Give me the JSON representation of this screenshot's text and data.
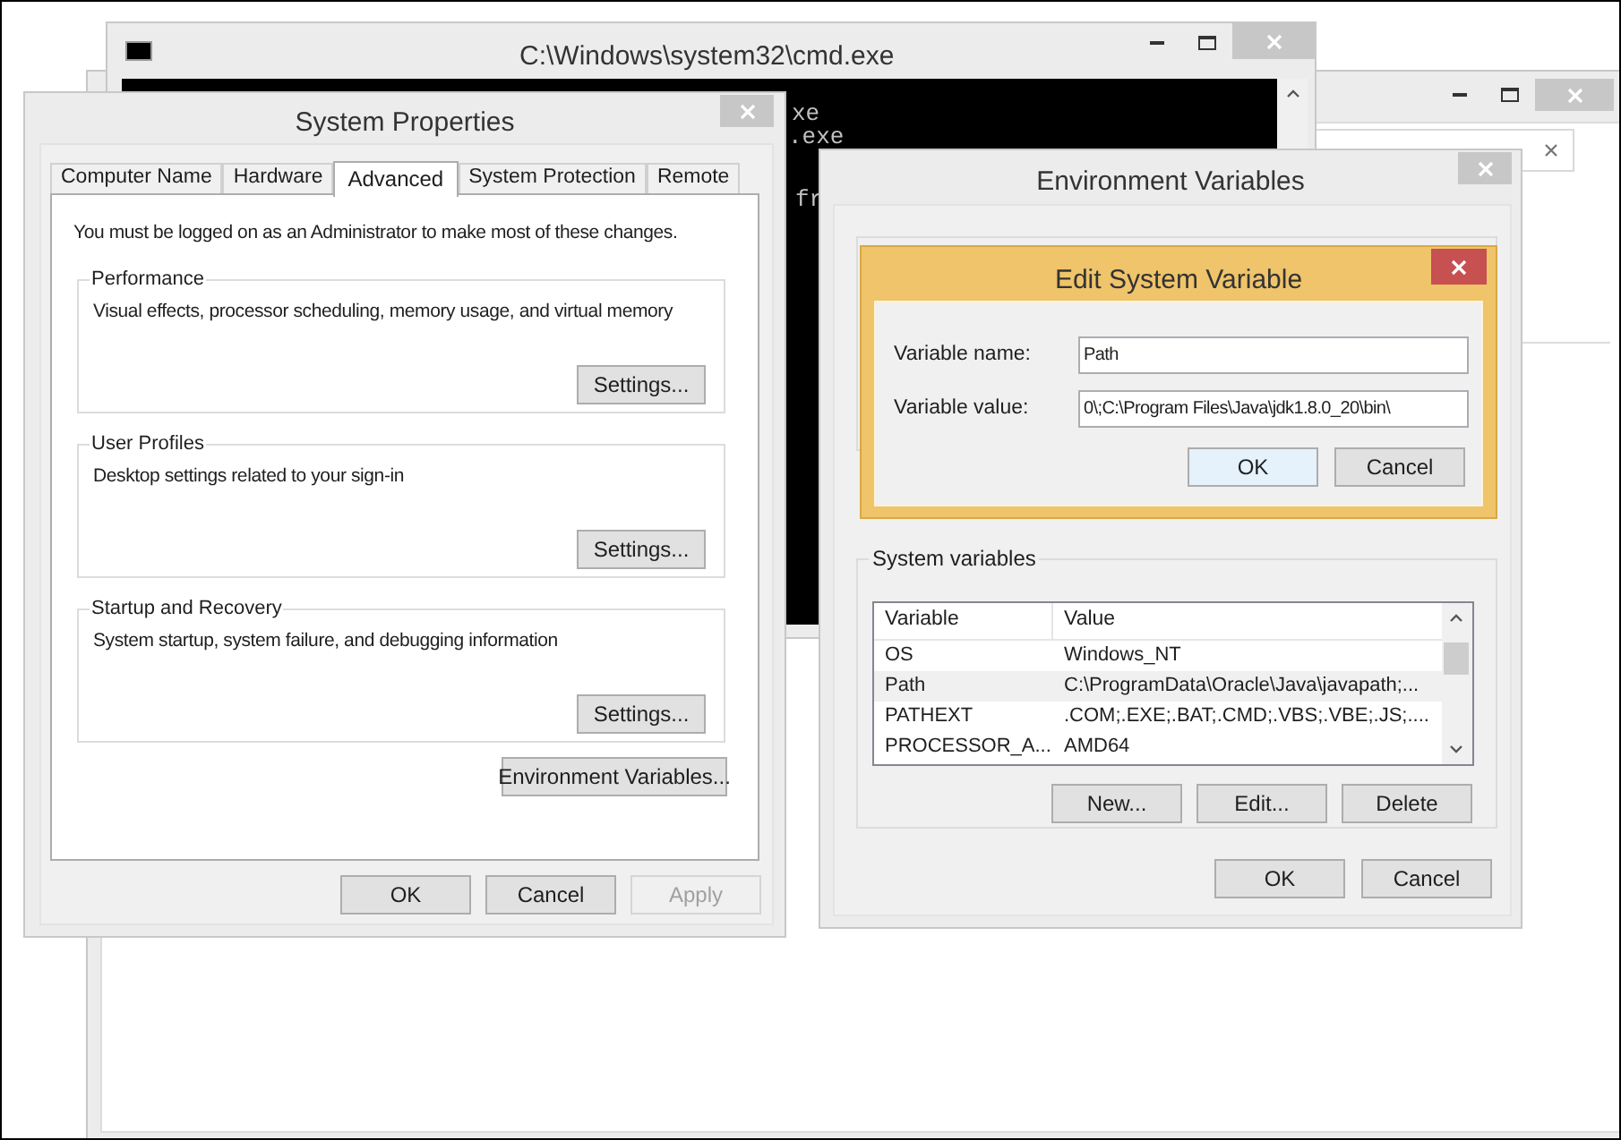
{
  "cmd_window": {
    "title": "C:\\Windows\\system32\\cmd.exe",
    "lines": [
      "xe",
      ".exe",
      "fr"
    ]
  },
  "system_properties": {
    "title": "System Properties",
    "tabs": [
      {
        "label": "Computer Name",
        "selected": false
      },
      {
        "label": "Hardware",
        "selected": false
      },
      {
        "label": "Advanced",
        "selected": true
      },
      {
        "label": "System Protection",
        "selected": false
      },
      {
        "label": "Remote",
        "selected": false
      }
    ],
    "notice": "You must be logged on as an Administrator to make most of these changes.",
    "groups": [
      {
        "title": "Performance",
        "description": "Visual effects, processor scheduling, memory usage, and virtual memory",
        "button": "Settings..."
      },
      {
        "title": "User Profiles",
        "description": "Desktop settings related to your sign-in",
        "button": "Settings..."
      },
      {
        "title": "Startup and Recovery",
        "description": "System startup, system failure, and debugging information",
        "button": "Settings..."
      }
    ],
    "env_button": "Environment Variables...",
    "buttons": [
      {
        "label": "OK",
        "disabled": false
      },
      {
        "label": "Cancel",
        "disabled": false
      },
      {
        "label": "Apply",
        "disabled": true
      }
    ]
  },
  "environment_variables": {
    "title": "Environment Variables",
    "system_variables": {
      "title": "System variables",
      "columns": [
        "Variable",
        "Value"
      ],
      "rows": [
        {
          "variable": "OS",
          "value": "Windows_NT",
          "selected": false
        },
        {
          "variable": "Path",
          "value": "C:\\ProgramData\\Oracle\\Java\\javapath;...",
          "selected": true
        },
        {
          "variable": "PATHEXT",
          "value": ".COM;.EXE;.BAT;.CMD;.VBS;.VBE;.JS;....",
          "selected": false
        },
        {
          "variable": "PROCESSOR_A...",
          "value": "AMD64",
          "selected": false
        }
      ],
      "buttons": [
        "New...",
        "Edit...",
        "Delete"
      ]
    },
    "buttons": [
      "OK",
      "Cancel"
    ]
  },
  "edit_dialog": {
    "title": "Edit System Variable",
    "fields": [
      {
        "label": "Variable name:",
        "value": "Path"
      },
      {
        "label": "Variable value:",
        "value": "0\\;C:\\Program Files\\Java\\jdk1.8.0_20\\bin\\"
      }
    ],
    "buttons": [
      {
        "label": "OK",
        "default": true
      },
      {
        "label": "Cancel",
        "default": false
      }
    ]
  }
}
